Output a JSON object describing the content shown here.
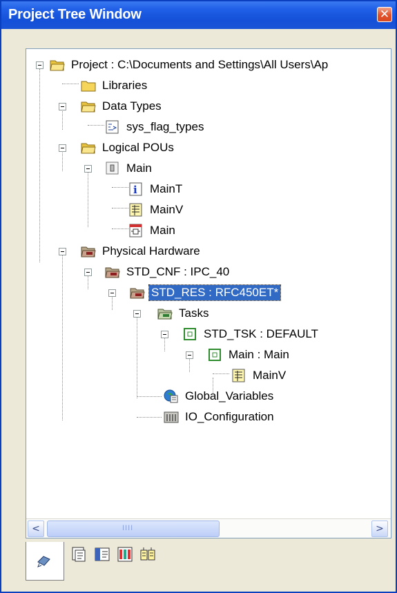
{
  "window": {
    "title": "Project Tree Window"
  },
  "tree": [
    {
      "label": "Project : C:\\Documents and Settings\\All Users\\Ap",
      "icon": "folder-open-icon"
    },
    {
      "label": "Libraries",
      "icon": "folder-icon"
    },
    {
      "label": "Data Types",
      "icon": "folder-open-icon"
    },
    {
      "label": "sys_flag_types",
      "icon": "data-type-icon"
    },
    {
      "label": "Logical POUs",
      "icon": "folder-open-icon"
    },
    {
      "label": "Main",
      "icon": "pou-icon"
    },
    {
      "label": "MainT",
      "icon": "info-icon"
    },
    {
      "label": "MainV",
      "icon": "variables-icon"
    },
    {
      "label": "Main",
      "icon": "code-worksheet-icon"
    },
    {
      "label": "Physical Hardware",
      "icon": "hardware-folder-icon"
    },
    {
      "label": "STD_CNF : IPC_40",
      "icon": "hardware-folder-icon"
    },
    {
      "label": "STD_RES : RFC450ET*",
      "icon": "hardware-folder-icon",
      "selected": true
    },
    {
      "label": "Tasks",
      "icon": "tasks-folder-icon"
    },
    {
      "label": "STD_TSK : DEFAULT",
      "icon": "task-icon"
    },
    {
      "label": "Main : Main",
      "icon": "program-instance-icon"
    },
    {
      "label": "MainV",
      "icon": "variables-icon"
    },
    {
      "label": "Global_Variables",
      "icon": "global-variables-icon"
    },
    {
      "label": "IO_Configuration",
      "icon": "io-configuration-icon"
    }
  ],
  "scrollbar": {
    "left_arrow": "<",
    "right_arrow": ">",
    "grip": "IIII"
  },
  "tabs": [
    "project-tree-tab-icon",
    "tab-2-icon",
    "tab-3-icon",
    "tab-4-icon",
    "tab-5-icon"
  ],
  "colors": {
    "selection": "#316ac5",
    "titlebar": "#1450d8",
    "window_bg": "#ece9d8"
  }
}
